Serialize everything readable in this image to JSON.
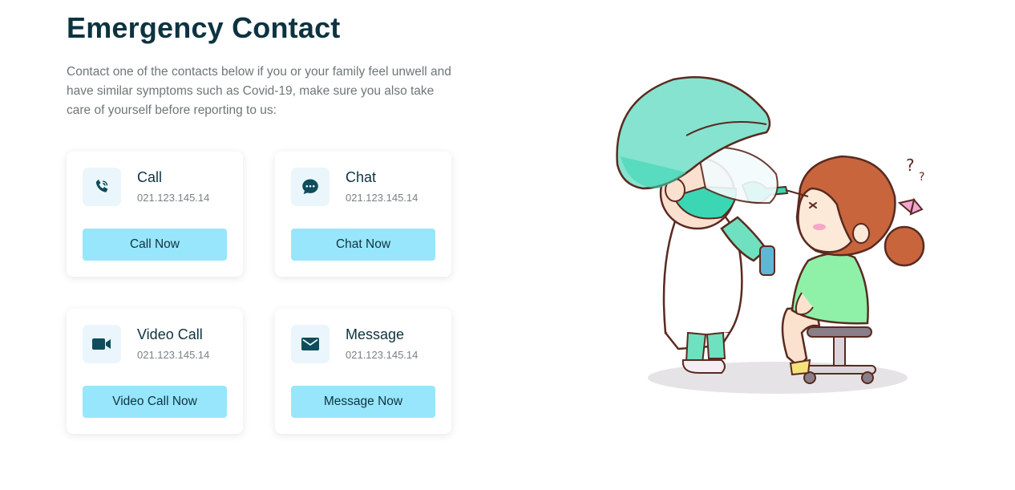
{
  "header": {
    "title": "Emergency Contact",
    "description": "Contact one of the contacts below if you or your family feel unwell and have similar symptoms such as Covid-19, make sure you also take care of yourself before reporting to us:"
  },
  "contacts": [
    {
      "title": "Call",
      "number": "021.123.145.14",
      "button": "Call Now",
      "icon": "phone-icon"
    },
    {
      "title": "Chat",
      "number": "021.123.145.14",
      "button": "Chat Now",
      "icon": "chat-icon"
    },
    {
      "title": "Video Call",
      "number": "021.123.145.14",
      "button": "Video Call Now",
      "icon": "video-camera-icon"
    },
    {
      "title": "Message",
      "number": "021.123.145.14",
      "button": "Message Now",
      "icon": "envelope-icon"
    }
  ],
  "colors": {
    "heading": "#0d3340",
    "button": "#98e6fc",
    "icon": "#0f4c5c",
    "icon_bg": "#eaf6fb"
  },
  "illustration": {
    "icon": "doctor-swab-test-illustration"
  }
}
